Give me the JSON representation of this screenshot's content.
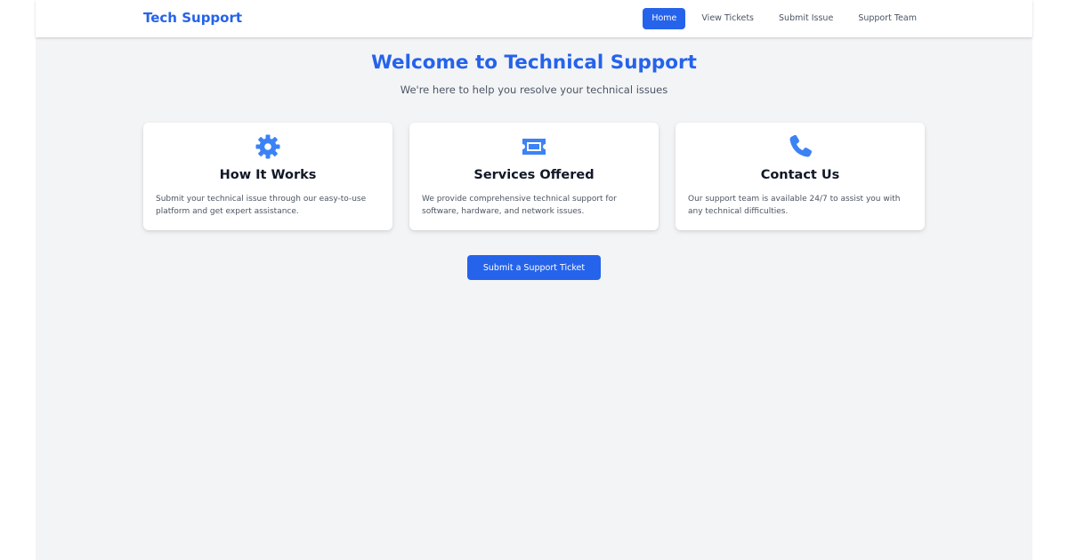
{
  "brand": "Tech Support",
  "nav": {
    "items": [
      {
        "label": "Home",
        "active": true
      },
      {
        "label": "View Tickets",
        "active": false
      },
      {
        "label": "Submit Issue",
        "active": false
      },
      {
        "label": "Support Team",
        "active": false
      }
    ]
  },
  "hero": {
    "title": "Welcome to Technical Support",
    "subtitle": "We're here to help you resolve your technical issues"
  },
  "cards": [
    {
      "icon": "gear-icon",
      "title": "How It Works",
      "text": "Submit your technical issue through our easy-to-use platform and get expert assistance."
    },
    {
      "icon": "ticket-icon",
      "title": "Services Offered",
      "text": "We provide comprehensive technical support for software, hardware, and network issues."
    },
    {
      "icon": "phone-icon",
      "title": "Contact Us",
      "text": "Our support team is available 24/7 to assist you with any technical difficulties."
    }
  ],
  "cta": {
    "label": "Submit a Support Ticket"
  },
  "colors": {
    "accent": "#2563eb",
    "background": "#f3f4f6",
    "icon": "#3b82f6"
  }
}
